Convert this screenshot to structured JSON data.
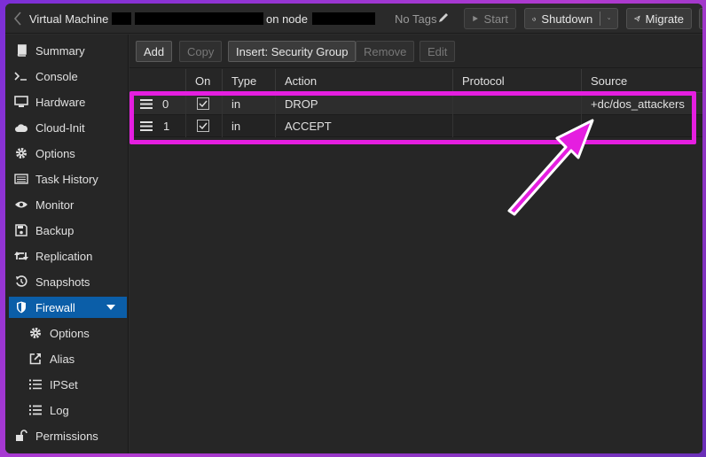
{
  "topbar": {
    "vm_label": "Virtual Machine",
    "node_label": "on node",
    "tags_label": "No Tags",
    "start_label": "Start",
    "shutdown_label": "Shutdown",
    "migrate_label": "Migrate"
  },
  "sidebar": {
    "items": [
      {
        "label": "Summary",
        "icon": "book-icon"
      },
      {
        "label": "Console",
        "icon": "terminal-icon"
      },
      {
        "label": "Hardware",
        "icon": "monitor-icon"
      },
      {
        "label": "Cloud-Init",
        "icon": "cloud-icon"
      },
      {
        "label": "Options",
        "icon": "gear-icon"
      },
      {
        "label": "Task History",
        "icon": "list-icon"
      },
      {
        "label": "Monitor",
        "icon": "eye-icon"
      },
      {
        "label": "Backup",
        "icon": "floppy-icon"
      },
      {
        "label": "Replication",
        "icon": "retweet-icon"
      },
      {
        "label": "Snapshots",
        "icon": "history-icon"
      },
      {
        "label": "Firewall",
        "icon": "shield-icon"
      },
      {
        "label": "Options",
        "icon": "gear-icon"
      },
      {
        "label": "Alias",
        "icon": "external-link-icon"
      },
      {
        "label": "IPSet",
        "icon": "list-ol-icon"
      },
      {
        "label": "Log",
        "icon": "list-icon"
      },
      {
        "label": "Permissions",
        "icon": "unlock-icon"
      }
    ]
  },
  "toolbar": {
    "add_label": "Add",
    "copy_label": "Copy",
    "insert_label": "Insert: Security Group",
    "remove_label": "Remove",
    "edit_label": "Edit"
  },
  "grid": {
    "columns": [
      "On",
      "Type",
      "Action",
      "Protocol",
      "Source"
    ],
    "rows": [
      {
        "pos": "0",
        "on": true,
        "type": "in",
        "action": "DROP",
        "protocol": "",
        "source": "+dc/dos_attackers"
      },
      {
        "pos": "1",
        "on": true,
        "type": "in",
        "action": "ACCEPT",
        "protocol": "",
        "source": ""
      }
    ]
  },
  "colors": {
    "accent": "#0b5ea8",
    "highlight": "#e51ee0"
  }
}
